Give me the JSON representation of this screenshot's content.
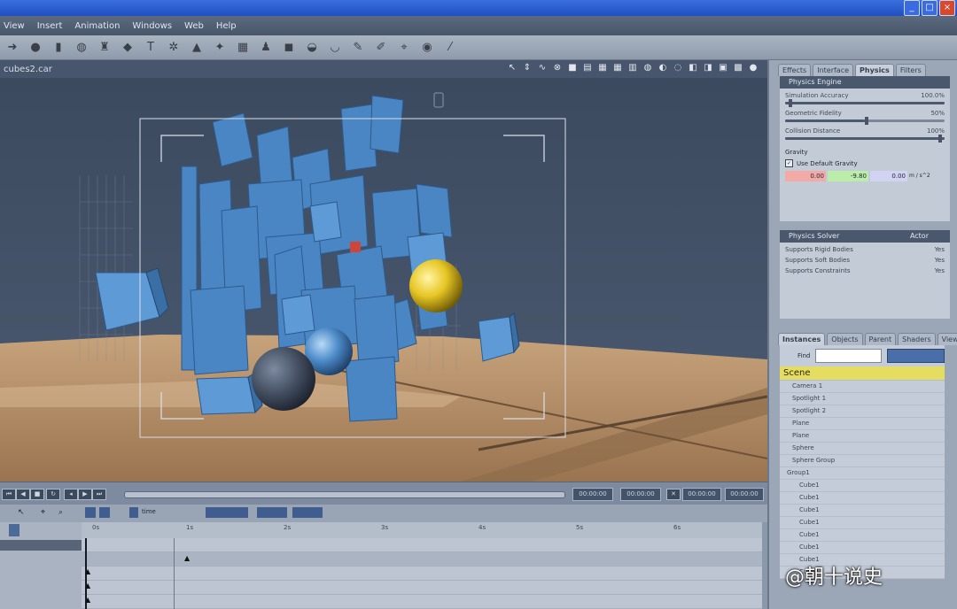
{
  "titlebar": {
    "buttons": [
      "_",
      "□",
      "×"
    ]
  },
  "menu": [
    "View",
    "Insert",
    "Animation",
    "Windows",
    "Web",
    "Help"
  ],
  "toolbar": {
    "count": 20
  },
  "viewport": {
    "title": "cubes2.car"
  },
  "panel": {
    "tabs": [
      "Effects",
      "Interface",
      "Physics",
      "Filters"
    ],
    "active_tab": "Physics",
    "engine": {
      "header": "Physics Engine",
      "sliders": [
        {
          "label": "Simulation Accuracy",
          "value": "100.0%",
          "level": 1.0
        },
        {
          "label": "Geometric Fidelity",
          "value": "50%",
          "level": 0.5
        },
        {
          "label": "Collision Distance",
          "value": "100%",
          "level": 1.0
        }
      ],
      "gravity_label": "Gravity",
      "use_default_gravity": "Use Default Gravity",
      "gravity_values": [
        "0.00",
        "-9.80",
        "0.00"
      ],
      "gravity_unit": "m / s^2"
    },
    "solver": {
      "header": "Physics Solver",
      "mode": "Actor",
      "rows": [
        {
          "label": "Supports Rigid Bodies",
          "value": "Yes"
        },
        {
          "label": "Supports Soft Bodies",
          "value": "Yes"
        },
        {
          "label": "Supports Constraints",
          "value": "Yes"
        }
      ]
    },
    "lower_tabs": [
      "Instances",
      "Objects",
      "Parent",
      "Shaders",
      "View"
    ],
    "find_label": "Find",
    "scene_header": "Scene",
    "scene_items": [
      "Camera 1",
      "Spotlight 1",
      "Spotlight 2",
      "Plane",
      "Plane",
      "Sphere",
      "Sphere Group",
      "Group1",
      "Cube1",
      "Cube1",
      "Cube1",
      "Cube1",
      "Cube1",
      "Cube1",
      "Cube1",
      "Cube1"
    ]
  },
  "timeline": {
    "time_fields": [
      "00:00:00",
      "00:00:00",
      "00:00:00",
      "00:00:00"
    ],
    "ticks": [
      "0s",
      "1s",
      "2s",
      "3s",
      "4s",
      "5s",
      "6s"
    ],
    "time_label": "time"
  },
  "watermark": "@朝十说史",
  "colors": {
    "sky": "#3f4e63",
    "ground": "#a67f5a",
    "cube": "#4a86c3",
    "yellow_sphere": "#e7c524",
    "blue_sphere": "#4d8bc9",
    "grey_sphere": "#4a5568"
  }
}
